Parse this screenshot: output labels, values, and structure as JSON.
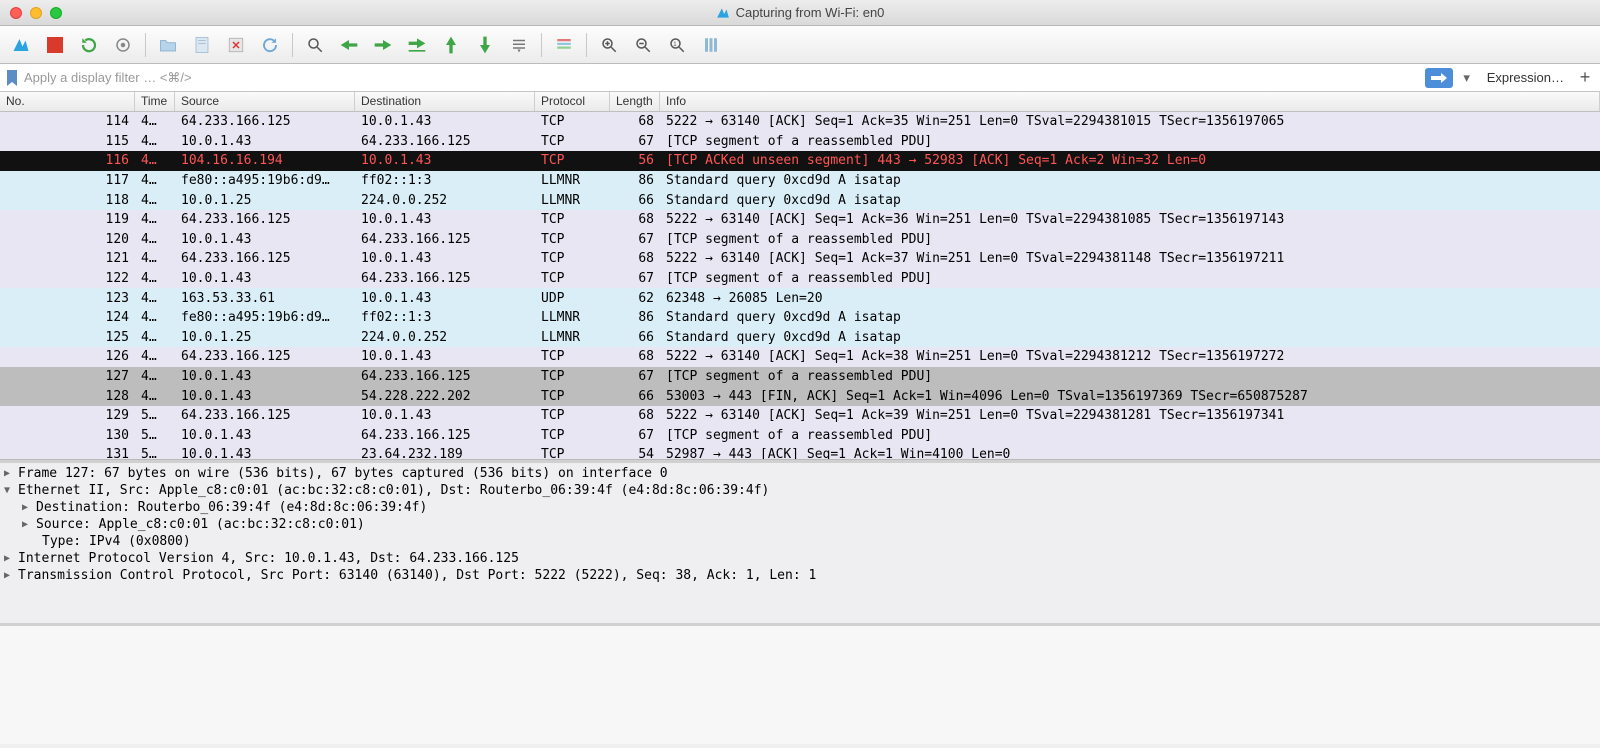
{
  "title": "Capturing from Wi-Fi: en0",
  "filter_placeholder": "Apply a display filter … <⌘/>",
  "expression_label": "Expression…",
  "columns": [
    "No.",
    "Time",
    "Source",
    "Destination",
    "Protocol",
    "Length",
    "Info"
  ],
  "packets": [
    {
      "no": "114",
      "time": "4…",
      "src": "64.233.166.125",
      "dst": "10.0.1.43",
      "proto": "TCP",
      "len": "68",
      "info": "5222 → 63140 [ACK] Seq=1 Ack=35 Win=251 Len=0 TSval=2294381015 TSecr=1356197065",
      "style": "lavender"
    },
    {
      "no": "115",
      "time": "4…",
      "src": "10.0.1.43",
      "dst": "64.233.166.125",
      "proto": "TCP",
      "len": "67",
      "info": "[TCP segment of a reassembled PDU]",
      "style": "lavender"
    },
    {
      "no": "116",
      "time": "4…",
      "src": "104.16.16.194",
      "dst": "10.0.1.43",
      "proto": "TCP",
      "len": "56",
      "info": "[TCP ACKed unseen segment] 443 → 52983 [ACK] Seq=1 Ack=2 Win=32 Len=0",
      "style": "black"
    },
    {
      "no": "117",
      "time": "4…",
      "src": "fe80::a495:19b6:d9…",
      "dst": "ff02::1:3",
      "proto": "LLMNR",
      "len": "86",
      "info": "Standard query 0xcd9d A isatap",
      "style": "lblue"
    },
    {
      "no": "118",
      "time": "4…",
      "src": "10.0.1.25",
      "dst": "224.0.0.252",
      "proto": "LLMNR",
      "len": "66",
      "info": "Standard query 0xcd9d A isatap",
      "style": "lblue"
    },
    {
      "no": "119",
      "time": "4…",
      "src": "64.233.166.125",
      "dst": "10.0.1.43",
      "proto": "TCP",
      "len": "68",
      "info": "5222 → 63140 [ACK] Seq=1 Ack=36 Win=251 Len=0 TSval=2294381085 TSecr=1356197143",
      "style": "lavender"
    },
    {
      "no": "120",
      "time": "4…",
      "src": "10.0.1.43",
      "dst": "64.233.166.125",
      "proto": "TCP",
      "len": "67",
      "info": "[TCP segment of a reassembled PDU]",
      "style": "lavender"
    },
    {
      "no": "121",
      "time": "4…",
      "src": "64.233.166.125",
      "dst": "10.0.1.43",
      "proto": "TCP",
      "len": "68",
      "info": "5222 → 63140 [ACK] Seq=1 Ack=37 Win=251 Len=0 TSval=2294381148 TSecr=1356197211",
      "style": "lavender"
    },
    {
      "no": "122",
      "time": "4…",
      "src": "10.0.1.43",
      "dst": "64.233.166.125",
      "proto": "TCP",
      "len": "67",
      "info": "[TCP segment of a reassembled PDU]",
      "style": "lavender"
    },
    {
      "no": "123",
      "time": "4…",
      "src": "163.53.33.61",
      "dst": "10.0.1.43",
      "proto": "UDP",
      "len": "62",
      "info": "62348 → 26085  Len=20",
      "style": "lblue"
    },
    {
      "no": "124",
      "time": "4…",
      "src": "fe80::a495:19b6:d9…",
      "dst": "ff02::1:3",
      "proto": "LLMNR",
      "len": "86",
      "info": "Standard query 0xcd9d A isatap",
      "style": "lblue"
    },
    {
      "no": "125",
      "time": "4…",
      "src": "10.0.1.25",
      "dst": "224.0.0.252",
      "proto": "LLMNR",
      "len": "66",
      "info": "Standard query 0xcd9d A isatap",
      "style": "lblue"
    },
    {
      "no": "126",
      "time": "4…",
      "src": "64.233.166.125",
      "dst": "10.0.1.43",
      "proto": "TCP",
      "len": "68",
      "info": "5222 → 63140 [ACK] Seq=1 Ack=38 Win=251 Len=0 TSval=2294381212 TSecr=1356197272",
      "style": "lavender"
    },
    {
      "no": "127",
      "time": "4…",
      "src": "10.0.1.43",
      "dst": "64.233.166.125",
      "proto": "TCP",
      "len": "67",
      "info": "[TCP segment of a reassembled PDU]",
      "style": "grey",
      "selected": true
    },
    {
      "no": "128",
      "time": "4…",
      "src": "10.0.1.43",
      "dst": "54.228.222.202",
      "proto": "TCP",
      "len": "66",
      "info": "53003 → 443 [FIN, ACK] Seq=1 Ack=1 Win=4096 Len=0 TSval=1356197369 TSecr=650875287",
      "style": "grey"
    },
    {
      "no": "129",
      "time": "5…",
      "src": "64.233.166.125",
      "dst": "10.0.1.43",
      "proto": "TCP",
      "len": "68",
      "info": "5222 → 63140 [ACK] Seq=1 Ack=39 Win=251 Len=0 TSval=2294381281 TSecr=1356197341",
      "style": "lavender"
    },
    {
      "no": "130",
      "time": "5…",
      "src": "10.0.1.43",
      "dst": "64.233.166.125",
      "proto": "TCP",
      "len": "67",
      "info": "[TCP segment of a reassembled PDU]",
      "style": "lavender"
    },
    {
      "no": "131",
      "time": "5…",
      "src": "10.0.1.43",
      "dst": "23.64.232.189",
      "proto": "TCP",
      "len": "54",
      "info": "52987 → 443 [ACK] Seq=1 Ack=1 Win=4100 Len=0",
      "style": "lavender"
    }
  ],
  "details": {
    "frame": "Frame 127: 67 bytes on wire (536 bits), 67 bytes captured (536 bits) on interface 0",
    "eth": "Ethernet II, Src: Apple_c8:c0:01 (ac:bc:32:c8:c0:01), Dst: Routerbo_06:39:4f (e4:8d:8c:06:39:4f)",
    "eth_dst": "Destination: Routerbo_06:39:4f (e4:8d:8c:06:39:4f)",
    "eth_src": "Source: Apple_c8:c0:01 (ac:bc:32:c8:c0:01)",
    "eth_type": "Type: IPv4 (0x0800)",
    "ip": "Internet Protocol Version 4, Src: 10.0.1.43, Dst: 64.233.166.125",
    "tcp": "Transmission Control Protocol, Src Port: 63140 (63140), Dst Port: 5222 (5222), Seq: 38, Ack: 1, Len: 1"
  },
  "toolbar_icons": [
    "fin",
    "stop",
    "restart",
    "options",
    "",
    "open",
    "save",
    "close",
    "reload",
    "",
    "find",
    "prev",
    "next",
    "jump",
    "first",
    "last",
    "",
    "autoscroll",
    "colorize",
    "",
    "zoom-in",
    "zoom-out",
    "zoom-reset",
    "resize-cols"
  ]
}
